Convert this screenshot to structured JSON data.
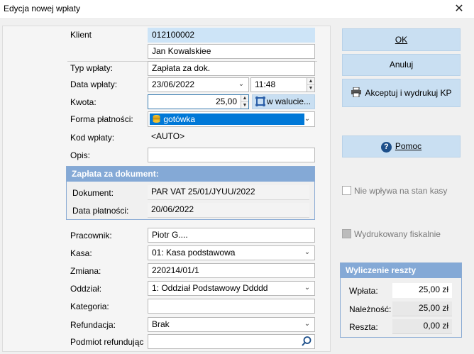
{
  "window": {
    "title": "Edycja nowej wpłaty",
    "close_glyph": "✕"
  },
  "form": {
    "client_label": "Klient",
    "client_code": "012100002",
    "client_name": "Jan Kowalskiee",
    "type_label": "Typ wpłaty:",
    "type_value": "Zapłata za dok.",
    "date_label": "Data wpłaty:",
    "date_value": "23/06/2022",
    "time_value": "11:48",
    "amount_label": "Kwota:",
    "amount_value": "25,00",
    "currency_button": "w walucie...",
    "method_label": "Forma płatności:",
    "method_value": "gotówka",
    "code_label": "Kod wpłaty:",
    "code_value": "<AUTO>",
    "desc_label": "Opis:",
    "desc_value": "",
    "doc_group_title": "Zapłata za dokument:",
    "doc_label": "Dokument:",
    "doc_value": "PAR VAT 25/01/JYUU/2022",
    "due_label": "Data płatności:",
    "due_value": "20/06/2022",
    "employee_label": "Pracownik:",
    "employee_value": "Piotr G....",
    "cash_label": "Kasa:",
    "cash_value": "01: Kasa podstawowa",
    "shift_label": "Zmiana:",
    "shift_value": "220214/01/1",
    "branch_label": "Oddział:",
    "branch_value": "1: Oddział Podstawowy Ddddd",
    "category_label": "Kategoria:",
    "category_value": "",
    "refund_label": "Refundacja:",
    "refund_value": "Brak",
    "refund_subject_label": "Podmiot refundując",
    "refund_subject_value": ""
  },
  "buttons": {
    "ok": "OK",
    "cancel": "Anuluj",
    "accept_print": "Akceptuj i wydrukuj KP",
    "help": "Pomoc"
  },
  "checkboxes": {
    "no_cash_effect": "Nie wpływa na stan kasy",
    "fiscal_printed": "Wydrukowany fiskalnie"
  },
  "change_calc": {
    "title": "Wyliczenie reszty",
    "paid_label": "Wpłata:",
    "paid_value": "25,00 zł",
    "due_label": "Należność:",
    "due_value": "25,00 zł",
    "change_label": "Reszta:",
    "change_value": "0,00 zł"
  },
  "colors": {
    "accent": "#c9dff2",
    "group_header": "#84a9d6",
    "selection": "#0078d7"
  }
}
